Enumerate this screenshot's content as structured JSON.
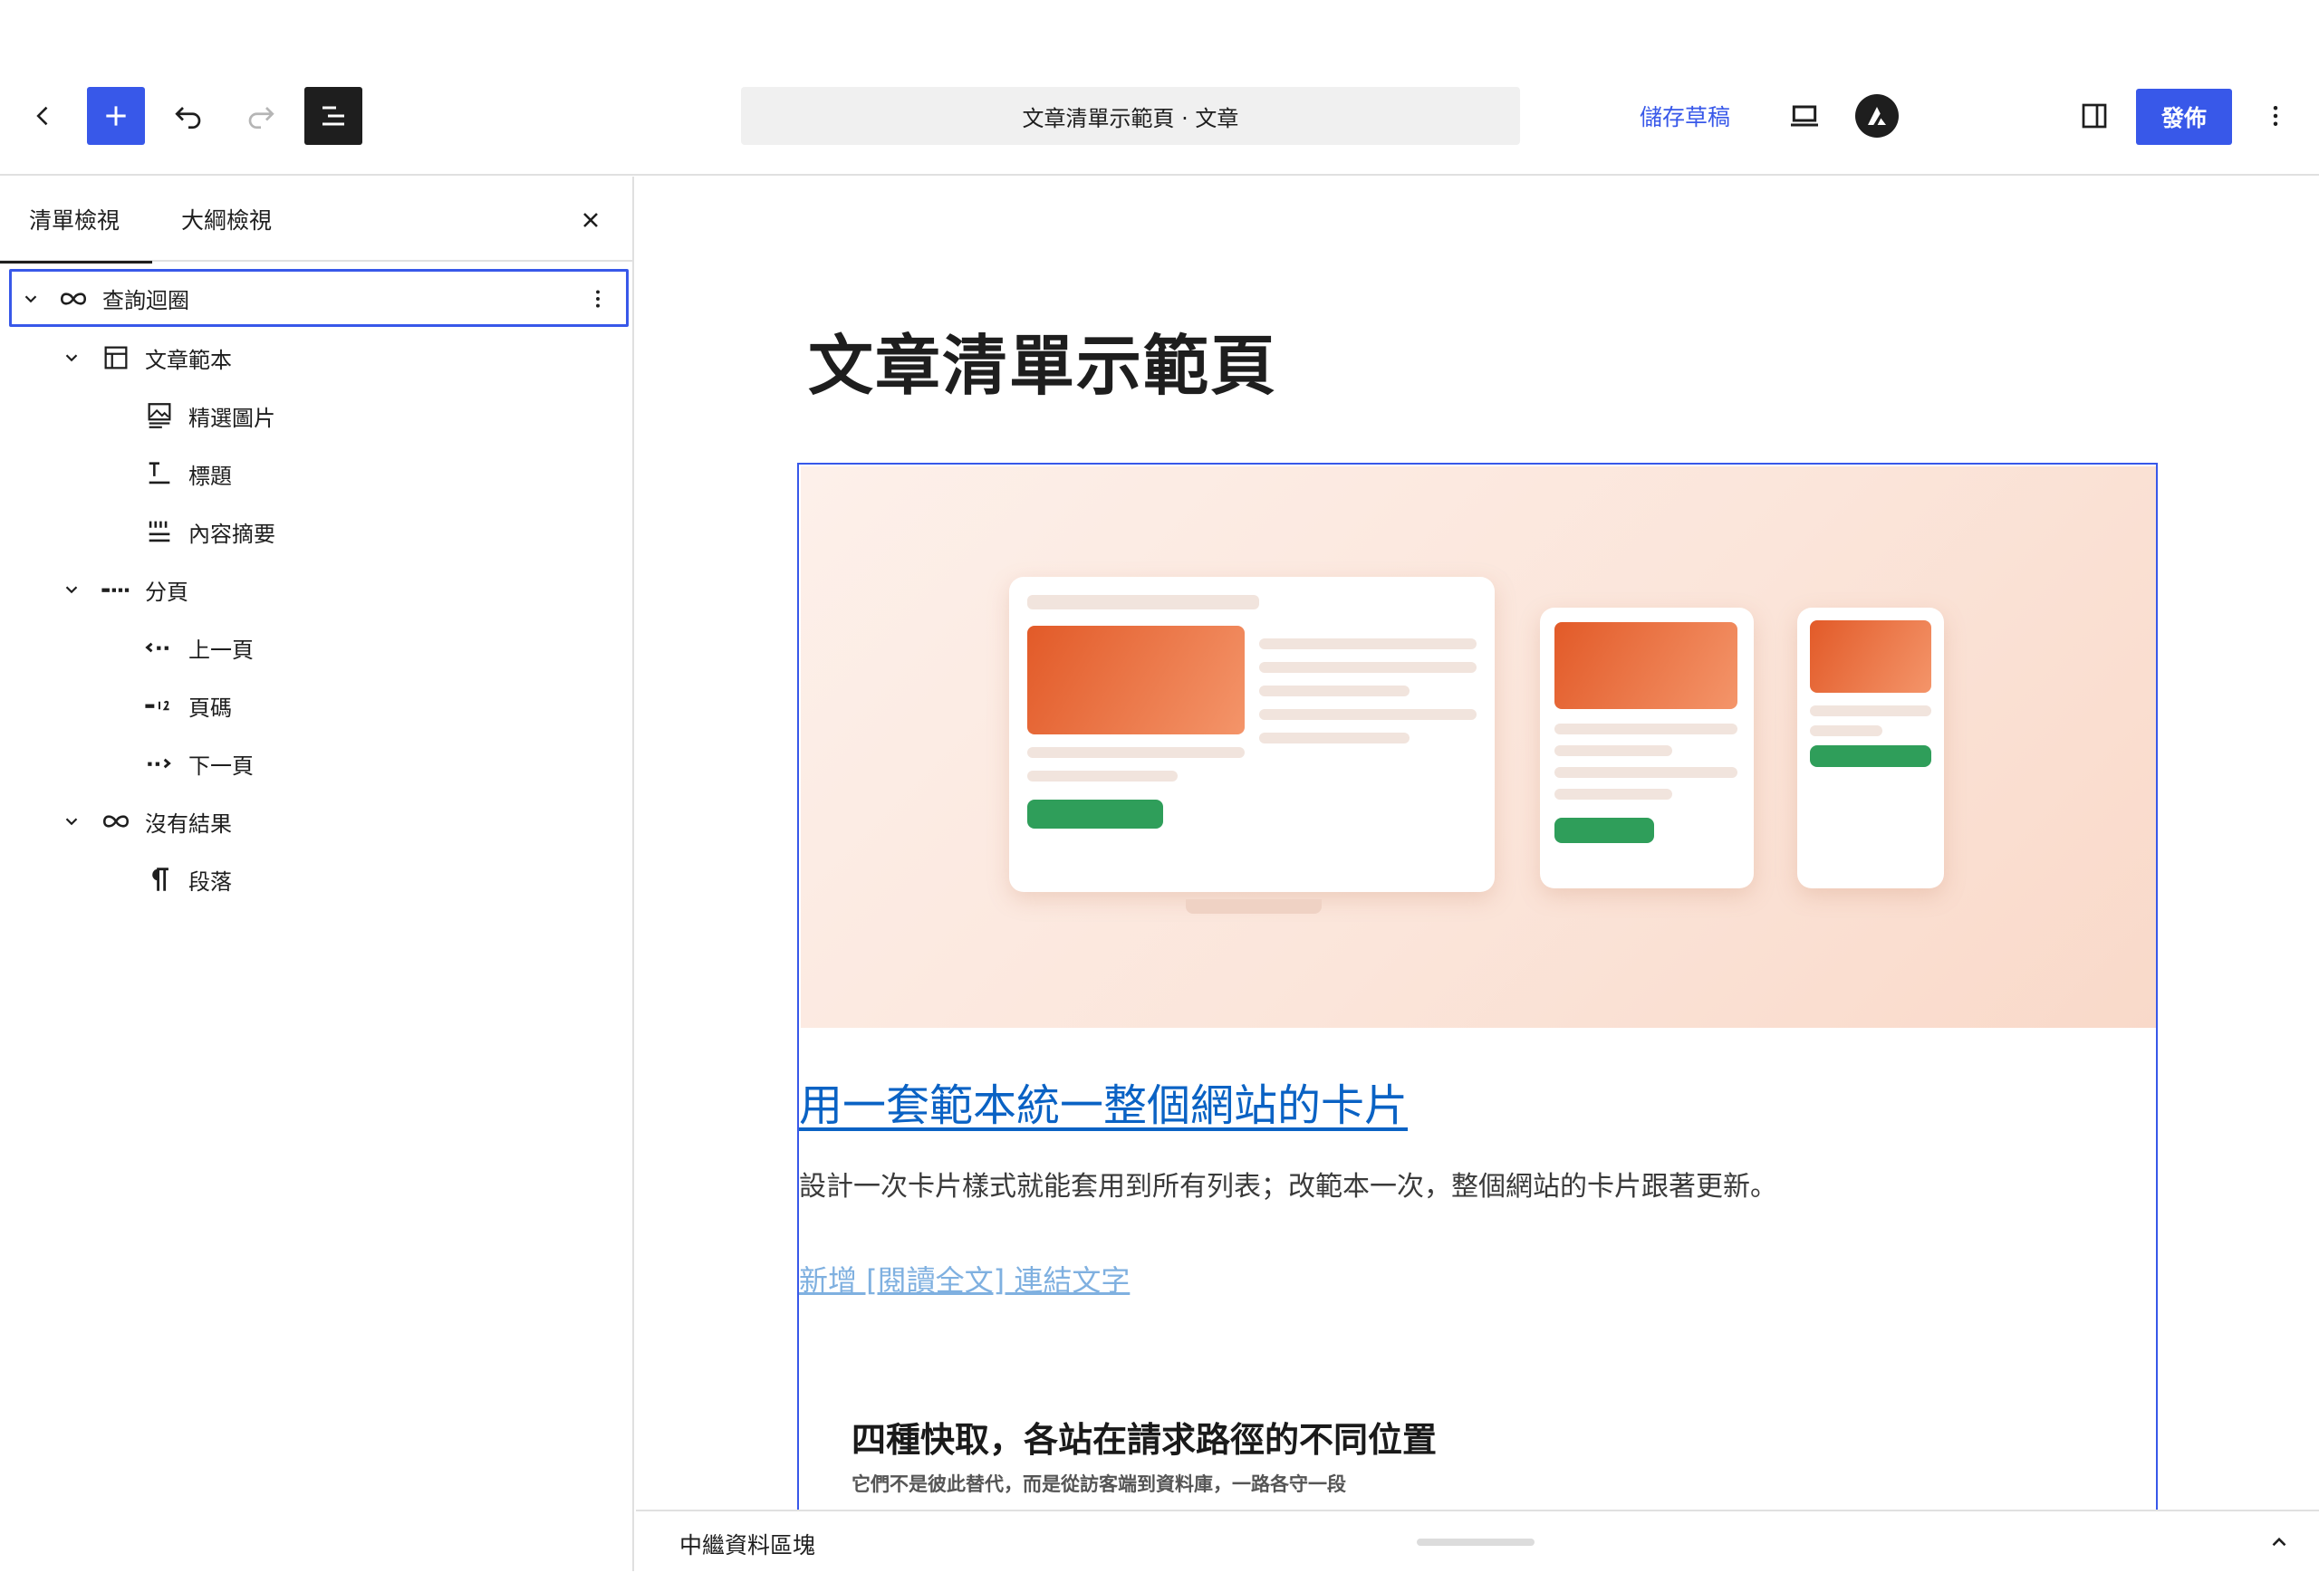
{
  "toolbar": {
    "document_title": "文章清單示範頁 · 文章",
    "save_draft_label": "儲存草稿",
    "publish_label": "發佈",
    "icons": [
      "back-icon",
      "plus-icon",
      "undo-icon",
      "redo-icon",
      "document-overview-icon",
      "desktop-view-icon",
      "astra-logo-icon",
      "sidebar-panel-icon",
      "more-vertical-icon"
    ],
    "accent_color": "#3858e9"
  },
  "sidebar": {
    "tabs": [
      {
        "label": "清單檢視",
        "active": true
      },
      {
        "label": "大綱檢視",
        "active": false
      }
    ],
    "tree": [
      {
        "label": "查詢迴圈",
        "icon": "loop-icon",
        "level": 0,
        "expanded": true,
        "selected": true
      },
      {
        "label": "文章範本",
        "icon": "layout-icon",
        "level": 1,
        "expanded": true
      },
      {
        "label": "精選圖片",
        "icon": "featured-image-icon",
        "level": 2
      },
      {
        "label": "標題",
        "icon": "title-icon",
        "level": 2
      },
      {
        "label": "內容摘要",
        "icon": "excerpt-icon",
        "level": 2
      },
      {
        "label": "分頁",
        "icon": "pagination-icon",
        "level": 1,
        "expanded": true
      },
      {
        "label": "上一頁",
        "icon": "previous-icon",
        "level": 2
      },
      {
        "label": "頁碼",
        "icon": "page-numbers-icon",
        "level": 2
      },
      {
        "label": "下一頁",
        "icon": "next-icon",
        "level": 2
      },
      {
        "label": "沒有結果",
        "icon": "loop-icon",
        "level": 1,
        "expanded": true
      },
      {
        "label": "段落",
        "icon": "paragraph-icon",
        "level": 2
      }
    ]
  },
  "canvas": {
    "page_title": "文章清單示範頁",
    "post": {
      "title": "用一套範本統一整個網站的卡片",
      "excerpt": "設計一次卡片樣式就能套用到所有列表；改範本一次，整個網站的卡片跟著更新。",
      "read_more": "新增 [閱讀全文] 連結文字"
    },
    "next_post": {
      "title": "四種快取，各站在請求路徑的不同位置",
      "subtitle": "它們不是彼此替代，而是從訪客端到資料庫，一路各守一段"
    }
  },
  "footer": {
    "label": "中繼資料區塊"
  }
}
